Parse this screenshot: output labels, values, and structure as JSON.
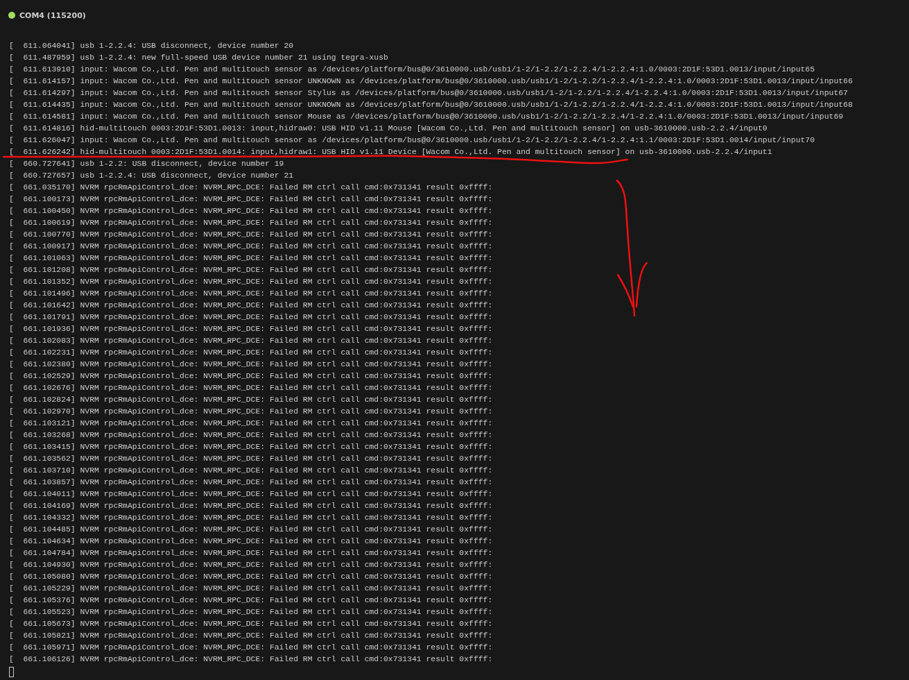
{
  "terminal": {
    "connected": true,
    "title": "COM4 (115200)",
    "lines": [
      "[  611.064041] usb 1-2.2.4: USB disconnect, device number 20",
      "[  611.487959] usb 1-2.2.4: new full-speed USB device number 21 using tegra-xusb",
      "[  611.613910] input: Wacom Co.,Ltd. Pen and multitouch sensor as /devices/platform/bus@0/3610000.usb/usb1/1-2/1-2.2/1-2.2.4/1-2.2.4:1.0/0003:2D1F:53D1.0013/input/input65",
      "[  611.614157] input: Wacom Co.,Ltd. Pen and multitouch sensor UNKNOWN as /devices/platform/bus@0/3610000.usb/usb1/1-2/1-2.2/1-2.2.4/1-2.2.4:1.0/0003:2D1F:53D1.0013/input/input66",
      "[  611.614297] input: Wacom Co.,Ltd. Pen and multitouch sensor Stylus as /devices/platform/bus@0/3610000.usb/usb1/1-2/1-2.2/1-2.2.4/1-2.2.4:1.0/0003:2D1F:53D1.0013/input/input67",
      "[  611.614435] input: Wacom Co.,Ltd. Pen and multitouch sensor UNKNOWN as /devices/platform/bus@0/3610000.usb/usb1/1-2/1-2.2/1-2.2.4/1-2.2.4:1.0/0003:2D1F:53D1.0013/input/input68",
      "[  611.614581] input: Wacom Co.,Ltd. Pen and multitouch sensor Mouse as /devices/platform/bus@0/3610000.usb/usb1/1-2/1-2.2/1-2.2.4/1-2.2.4:1.0/0003:2D1F:53D1.0013/input/input69",
      "[  611.614816] hid-multitouch 0003:2D1F:53D1.0013: input,hidraw0: USB HID v1.11 Mouse [Wacom Co.,Ltd. Pen and multitouch sensor] on usb-3610000.usb-2.2.4/input0",
      "[  611.626047] input: Wacom Co.,Ltd. Pen and multitouch sensor as /devices/platform/bus@0/3610000.usb/usb1/1-2/1-2.2/1-2.2.4/1-2.2.4:1.1/0003:2D1F:53D1.0014/input/input70",
      "[  611.626242] hid-multitouch 0003:2D1F:53D1.0014: input,hidraw1: USB HID v1.11 Device [Wacom Co.,Ltd. Pen and multitouch sensor] on usb-3610000.usb-2.2.4/input1",
      "[  660.727641] usb 1-2.2: USB disconnect, device number 19",
      "[  660.727657] usb 1-2.2.4: USB disconnect, device number 21",
      "[  661.035170] NVRM rpcRmApiControl_dce: NVRM_RPC_DCE: Failed RM ctrl call cmd:0x731341 result 0xffff:",
      "[  661.100173] NVRM rpcRmApiControl_dce: NVRM_RPC_DCE: Failed RM ctrl call cmd:0x731341 result 0xffff:",
      "[  661.100450] NVRM rpcRmApiControl_dce: NVRM_RPC_DCE: Failed RM ctrl call cmd:0x731341 result 0xffff:",
      "[  661.100619] NVRM rpcRmApiControl_dce: NVRM_RPC_DCE: Failed RM ctrl call cmd:0x731341 result 0xffff:",
      "[  661.100770] NVRM rpcRmApiControl_dce: NVRM_RPC_DCE: Failed RM ctrl call cmd:0x731341 result 0xffff:",
      "[  661.100917] NVRM rpcRmApiControl_dce: NVRM_RPC_DCE: Failed RM ctrl call cmd:0x731341 result 0xffff:",
      "[  661.101063] NVRM rpcRmApiControl_dce: NVRM_RPC_DCE: Failed RM ctrl call cmd:0x731341 result 0xffff:",
      "[  661.101208] NVRM rpcRmApiControl_dce: NVRM_RPC_DCE: Failed RM ctrl call cmd:0x731341 result 0xffff:",
      "[  661.101352] NVRM rpcRmApiControl_dce: NVRM_RPC_DCE: Failed RM ctrl call cmd:0x731341 result 0xffff:",
      "[  661.101496] NVRM rpcRmApiControl_dce: NVRM_RPC_DCE: Failed RM ctrl call cmd:0x731341 result 0xffff:",
      "[  661.101642] NVRM rpcRmApiControl_dce: NVRM_RPC_DCE: Failed RM ctrl call cmd:0x731341 result 0xffff:",
      "[  661.101791] NVRM rpcRmApiControl_dce: NVRM_RPC_DCE: Failed RM ctrl call cmd:0x731341 result 0xffff:",
      "[  661.101936] NVRM rpcRmApiControl_dce: NVRM_RPC_DCE: Failed RM ctrl call cmd:0x731341 result 0xffff:",
      "[  661.102083] NVRM rpcRmApiControl_dce: NVRM_RPC_DCE: Failed RM ctrl call cmd:0x731341 result 0xffff:",
      "[  661.102231] NVRM rpcRmApiControl_dce: NVRM_RPC_DCE: Failed RM ctrl call cmd:0x731341 result 0xffff:",
      "[  661.102380] NVRM rpcRmApiControl_dce: NVRM_RPC_DCE: Failed RM ctrl call cmd:0x731341 result 0xffff:",
      "[  661.102529] NVRM rpcRmApiControl_dce: NVRM_RPC_DCE: Failed RM ctrl call cmd:0x731341 result 0xffff:",
      "[  661.102676] NVRM rpcRmApiControl_dce: NVRM_RPC_DCE: Failed RM ctrl call cmd:0x731341 result 0xffff:",
      "[  661.102824] NVRM rpcRmApiControl_dce: NVRM_RPC_DCE: Failed RM ctrl call cmd:0x731341 result 0xffff:",
      "[  661.102970] NVRM rpcRmApiControl_dce: NVRM_RPC_DCE: Failed RM ctrl call cmd:0x731341 result 0xffff:",
      "[  661.103121] NVRM rpcRmApiControl_dce: NVRM_RPC_DCE: Failed RM ctrl call cmd:0x731341 result 0xffff:",
      "[  661.103268] NVRM rpcRmApiControl_dce: NVRM_RPC_DCE: Failed RM ctrl call cmd:0x731341 result 0xffff:",
      "[  661.103415] NVRM rpcRmApiControl_dce: NVRM_RPC_DCE: Failed RM ctrl call cmd:0x731341 result 0xffff:",
      "[  661.103562] NVRM rpcRmApiControl_dce: NVRM_RPC_DCE: Failed RM ctrl call cmd:0x731341 result 0xffff:",
      "[  661.103710] NVRM rpcRmApiControl_dce: NVRM_RPC_DCE: Failed RM ctrl call cmd:0x731341 result 0xffff:",
      "[  661.103857] NVRM rpcRmApiControl_dce: NVRM_RPC_DCE: Failed RM ctrl call cmd:0x731341 result 0xffff:",
      "[  661.104011] NVRM rpcRmApiControl_dce: NVRM_RPC_DCE: Failed RM ctrl call cmd:0x731341 result 0xffff:",
      "[  661.104169] NVRM rpcRmApiControl_dce: NVRM_RPC_DCE: Failed RM ctrl call cmd:0x731341 result 0xffff:",
      "[  661.104332] NVRM rpcRmApiControl_dce: NVRM_RPC_DCE: Failed RM ctrl call cmd:0x731341 result 0xffff:",
      "[  661.104485] NVRM rpcRmApiControl_dce: NVRM_RPC_DCE: Failed RM ctrl call cmd:0x731341 result 0xffff:",
      "[  661.104634] NVRM rpcRmApiControl_dce: NVRM_RPC_DCE: Failed RM ctrl call cmd:0x731341 result 0xffff:",
      "[  661.104784] NVRM rpcRmApiControl_dce: NVRM_RPC_DCE: Failed RM ctrl call cmd:0x731341 result 0xffff:",
      "[  661.104930] NVRM rpcRmApiControl_dce: NVRM_RPC_DCE: Failed RM ctrl call cmd:0x731341 result 0xffff:",
      "[  661.105080] NVRM rpcRmApiControl_dce: NVRM_RPC_DCE: Failed RM ctrl call cmd:0x731341 result 0xffff:",
      "[  661.105229] NVRM rpcRmApiControl_dce: NVRM_RPC_DCE: Failed RM ctrl call cmd:0x731341 result 0xffff:",
      "[  661.105376] NVRM rpcRmApiControl_dce: NVRM_RPC_DCE: Failed RM ctrl call cmd:0x731341 result 0xffff:",
      "[  661.105523] NVRM rpcRmApiControl_dce: NVRM_RPC_DCE: Failed RM ctrl call cmd:0x731341 result 0xffff:",
      "[  661.105673] NVRM rpcRmApiControl_dce: NVRM_RPC_DCE: Failed RM ctrl call cmd:0x731341 result 0xffff:",
      "[  661.105821] NVRM rpcRmApiControl_dce: NVRM_RPC_DCE: Failed RM ctrl call cmd:0x731341 result 0xffff:",
      "[  661.105971] NVRM rpcRmApiControl_dce: NVRM_RPC_DCE: Failed RM ctrl call cmd:0x731341 result 0xffff:",
      "[  661.106126] NVRM rpcRmApiControl_dce: NVRM_RPC_DCE: Failed RM ctrl call cmd:0x731341 result 0xffff:"
    ]
  }
}
